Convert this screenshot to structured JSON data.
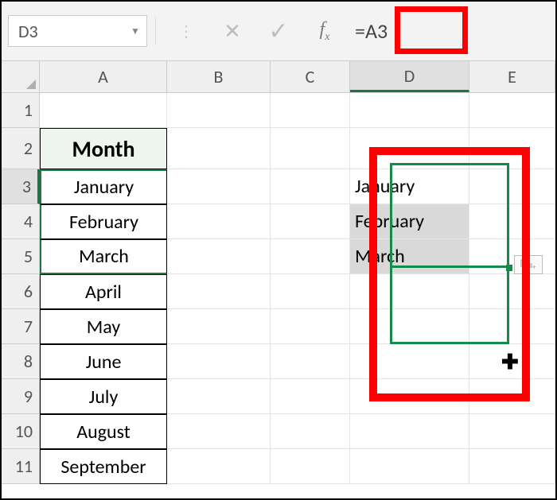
{
  "formula_bar": {
    "name_box": "D3",
    "cancel_icon": "✕",
    "enter_icon": "✓",
    "fx_label": "fx",
    "formula": "=A3"
  },
  "columns": [
    "A",
    "B",
    "C",
    "D",
    "E"
  ],
  "row_headers": [
    "1",
    "2",
    "3",
    "4",
    "5",
    "6",
    "7",
    "8",
    "9",
    "10",
    "11"
  ],
  "header_cell": "Month",
  "months": [
    "January",
    "February",
    "March",
    "April",
    "May",
    "June",
    "July",
    "August",
    "September"
  ],
  "d_values": [
    "January",
    "February",
    "March"
  ],
  "autofill_tooltip": "Auto Fill Options"
}
